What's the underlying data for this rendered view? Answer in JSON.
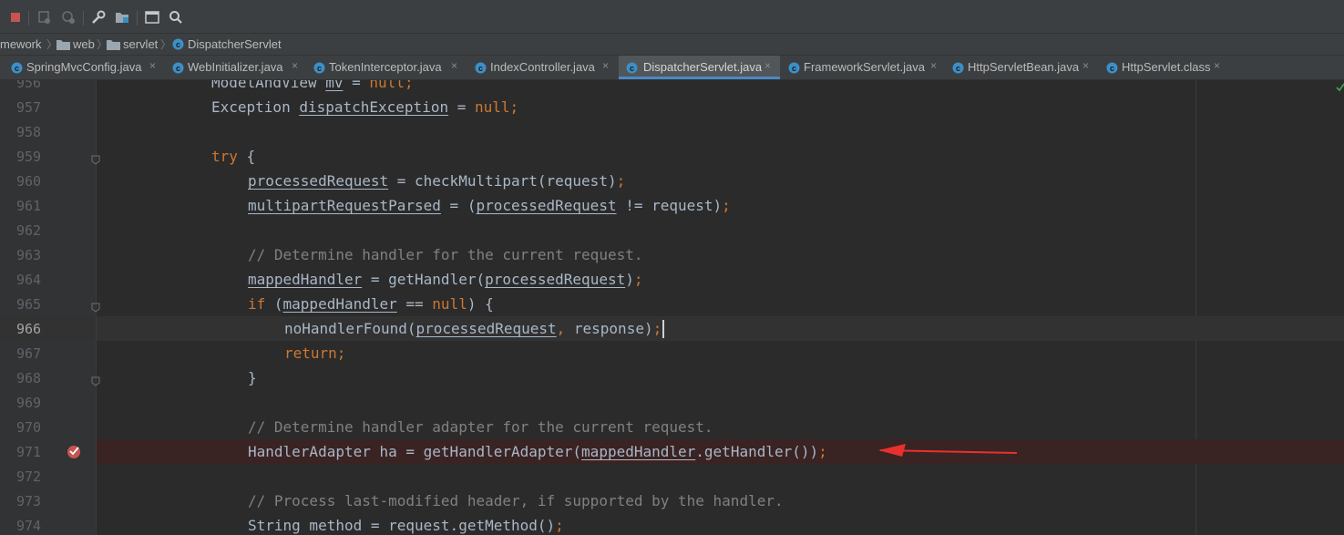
{
  "toolbar": {
    "buttons": [
      {
        "name": "stop-icon",
        "color": "#c75450"
      },
      {
        "name": "rerun-icon"
      },
      {
        "name": "debug-config-icon"
      },
      {
        "name": "wrench-icon"
      },
      {
        "name": "project-structure-icon"
      },
      {
        "name": "terminal-icon"
      },
      {
        "name": "search-icon"
      }
    ]
  },
  "breadcrumb": {
    "items": [
      "mework",
      "web",
      "servlet",
      "DispatcherServlet"
    ]
  },
  "tabs": [
    {
      "label": "SpringMvcConfig.java",
      "icon": "class-icon",
      "close": "×",
      "active": false
    },
    {
      "label": "WebInitializer.java",
      "icon": "class-icon",
      "close": "×",
      "active": false
    },
    {
      "label": "TokenInterceptor.java",
      "icon": "class-icon",
      "close": "×",
      "active": false
    },
    {
      "label": "IndexController.java",
      "icon": "class-icon",
      "close": "×",
      "active": false
    },
    {
      "label": "DispatcherServlet.java",
      "icon": "class-icon",
      "close": "×",
      "active": true
    },
    {
      "label": "FrameworkServlet.java",
      "icon": "class-icon",
      "close": "×",
      "active": false
    },
    {
      "label": "HttpServletBean.java",
      "icon": "class-icon",
      "close": "×",
      "active": false
    },
    {
      "label": "HttpServlet.class",
      "icon": "class-icon",
      "close": "×",
      "active": false
    }
  ],
  "colors": {
    "accent": "#4a88c7",
    "keyword": "#cc7832",
    "comment": "#808080",
    "code": "#a9b7c6",
    "breakpoint": "#c75450",
    "arrow": "#e8312d"
  },
  "editor": {
    "lines": [
      {
        "num": "956",
        "tokens": [
          [
            "ModelAndView ",
            "plain"
          ],
          [
            "mv",
            "field"
          ],
          [
            " = ",
            "plain"
          ],
          [
            "null",
            "kw"
          ],
          [
            ";",
            "kw"
          ]
        ]
      },
      {
        "num": "957",
        "tokens": [
          [
            "Exception ",
            "plain"
          ],
          [
            "dispatchException",
            "field"
          ],
          [
            " = ",
            "plain"
          ],
          [
            "null",
            "kw"
          ],
          [
            ";",
            "kw"
          ]
        ]
      },
      {
        "num": "958",
        "tokens": []
      },
      {
        "num": "959",
        "tokens": [
          [
            "try",
            "kw"
          ],
          [
            " {",
            "plain"
          ]
        ]
      },
      {
        "num": "960",
        "tokens": [
          [
            "processedRequest",
            "field"
          ],
          [
            " = checkMultipart(request)",
            "plain"
          ],
          [
            ";",
            "kw"
          ]
        ]
      },
      {
        "num": "961",
        "tokens": [
          [
            "multipartRequestParsed",
            "field"
          ],
          [
            " = (",
            "plain"
          ],
          [
            "processedRequest",
            "field"
          ],
          [
            " != request)",
            "plain"
          ],
          [
            ";",
            "kw"
          ]
        ]
      },
      {
        "num": "962",
        "tokens": []
      },
      {
        "num": "963",
        "tokens": [
          [
            "// Determine handler for the current request.",
            "comment"
          ]
        ]
      },
      {
        "num": "964",
        "tokens": [
          [
            "mappedHandler",
            "field"
          ],
          [
            " = getHandler(",
            "plain"
          ],
          [
            "processedRequest",
            "field"
          ],
          [
            ")",
            "plain"
          ],
          [
            ";",
            "kw"
          ]
        ]
      },
      {
        "num": "965",
        "tokens": [
          [
            "if",
            "kw"
          ],
          [
            " (",
            "plain"
          ],
          [
            "mappedHandler",
            "field"
          ],
          [
            " == ",
            "plain"
          ],
          [
            "null",
            "kw"
          ],
          [
            ") {",
            "plain"
          ]
        ]
      },
      {
        "num": "966",
        "tokens": [
          [
            "noHandlerFound(",
            "plain"
          ],
          [
            "processedRequest",
            "field"
          ],
          [
            ", ",
            "kw"
          ],
          [
            "response)",
            "plain"
          ],
          [
            ";",
            "kw"
          ]
        ]
      },
      {
        "num": "967",
        "tokens": [
          [
            "return",
            "kw"
          ],
          [
            ";",
            "kw"
          ]
        ]
      },
      {
        "num": "968",
        "tokens": [
          [
            "}",
            "plain"
          ]
        ]
      },
      {
        "num": "969",
        "tokens": []
      },
      {
        "num": "970",
        "tokens": [
          [
            "// Determine handler adapter for the current request.",
            "comment"
          ]
        ]
      },
      {
        "num": "971",
        "tokens": [
          [
            "HandlerAdapter ha = getHandlerAdapter(",
            "plain"
          ],
          [
            "mappedHandler",
            "field"
          ],
          [
            ".getHandler())",
            "plain"
          ],
          [
            ";",
            "kw"
          ]
        ]
      },
      {
        "num": "972",
        "tokens": []
      },
      {
        "num": "973",
        "tokens": [
          [
            "// Process last-modified header, if supported by the handler.",
            "comment"
          ]
        ]
      },
      {
        "num": "974",
        "tokens": [
          [
            "String method = request.getMethod()",
            "plain"
          ],
          [
            ";",
            "kw"
          ]
        ]
      }
    ]
  }
}
